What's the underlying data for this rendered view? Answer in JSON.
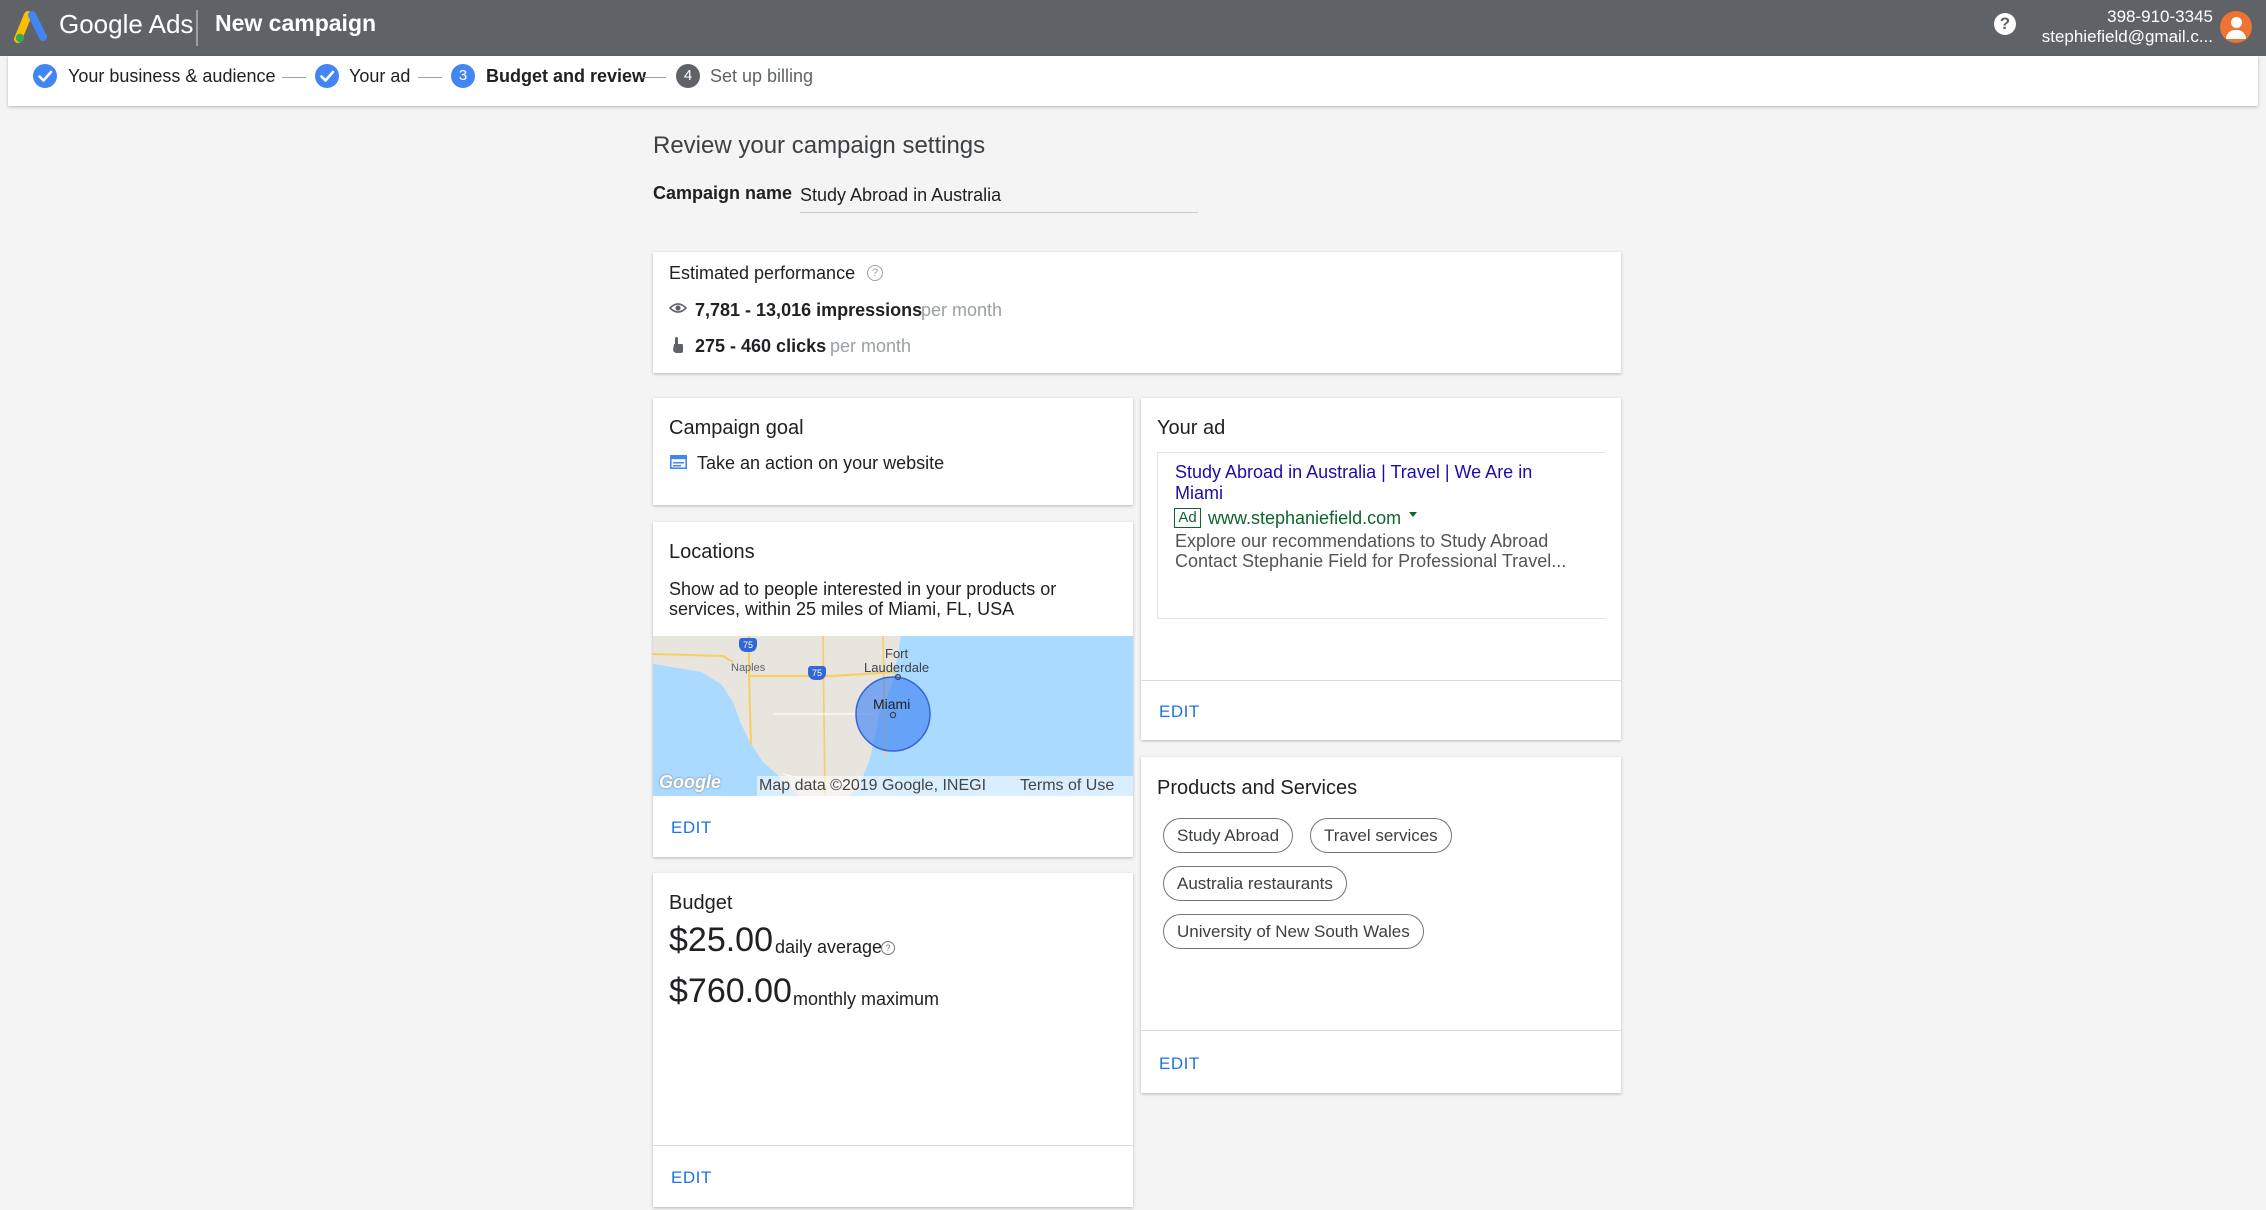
{
  "app": {
    "brand": "Google Ads",
    "page_title": "New campaign"
  },
  "account": {
    "phone": "398-910-3345",
    "email": "stephiefield@gmail.c..."
  },
  "steps": [
    {
      "label": "Your business & audience",
      "state": "done"
    },
    {
      "label": "Your ad",
      "state": "done"
    },
    {
      "number": "3",
      "label": "Budget and review",
      "state": "active"
    },
    {
      "number": "4",
      "label": "Set up billing",
      "state": "idle"
    }
  ],
  "review": {
    "heading": "Review your campaign settings",
    "campaign_name_label": "Campaign name",
    "campaign_name_value": "Study Abroad in Australia"
  },
  "performance": {
    "title": "Estimated performance",
    "impressions": "7,781 - 13,016 impressions",
    "impressions_unit": "per month",
    "clicks": "275 - 460 clicks",
    "clicks_unit": "per month"
  },
  "goal": {
    "title": "Campaign goal",
    "value": "Take an action on your website"
  },
  "locations": {
    "title": "Locations",
    "desc_line1": "Show ad to people interested in your products or",
    "desc_line2": "services, within 25 miles of Miami, FL, USA",
    "map": {
      "city_main": "Miami",
      "city_fort1": "Fort",
      "city_fort2": "Lauderdale",
      "city_naples": "Naples",
      "highway1": "75",
      "highway2": "75",
      "logo": "Google",
      "attribution": "Map data ©2019 Google, INEGI",
      "terms": "Terms of Use"
    },
    "edit": "EDIT"
  },
  "budget": {
    "title": "Budget",
    "daily_amount": "$25.00",
    "daily_label": "daily average",
    "monthly_amount": "$760.00",
    "monthly_label": "monthly maximum",
    "edit": "EDIT"
  },
  "ad": {
    "title": "Your ad",
    "headline_line1": "Study Abroad in Australia | Travel | We Are in",
    "headline_line2": "Miami",
    "badge": "Ad",
    "url": "www.stephaniefield.com",
    "desc_line1": "Explore our recommendations to Study Abroad",
    "desc_line2": "Contact Stephanie Field for Professional Travel...",
    "edit": "EDIT"
  },
  "products": {
    "title": "Products and Services",
    "chips": [
      "Study Abroad",
      "Travel services",
      "Australia restaurants",
      "University of New South Wales"
    ],
    "edit": "EDIT"
  },
  "colors": {
    "topbar": "#5f6368",
    "accent": "#4285f4",
    "link": "#1a73e8",
    "ad_green": "#0d652d",
    "ad_headline": "#1a0dab"
  }
}
